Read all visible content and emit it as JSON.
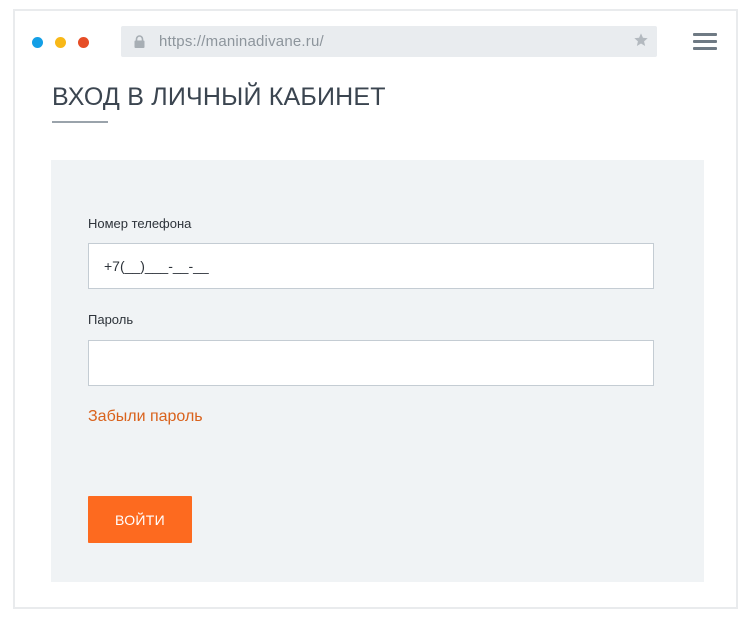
{
  "browser": {
    "url": "https://maninadivane.ru/",
    "dots": [
      {
        "name": "blue",
        "color": "#139fe6"
      },
      {
        "name": "yellow",
        "color": "#f8b817"
      },
      {
        "name": "red",
        "color": "#e64d26"
      }
    ],
    "icons": [
      "lock-icon",
      "star-icon",
      "hamburger-menu-icon"
    ]
  },
  "page": {
    "title": "ВХОД В ЛИЧНЫЙ КАБИНЕТ"
  },
  "form": {
    "phone_label": "Номер телефона",
    "phone_value": "+7(__)___-__-__",
    "password_label": "Пароль",
    "password_value": "",
    "forgot_link": "Забыли пароль",
    "submit_label": "ВОЙТИ"
  },
  "colors": {
    "accent": "#fd6a1f",
    "link": "#d9621c",
    "panel_bg": "#f0f3f5",
    "title": "#3b4550"
  }
}
